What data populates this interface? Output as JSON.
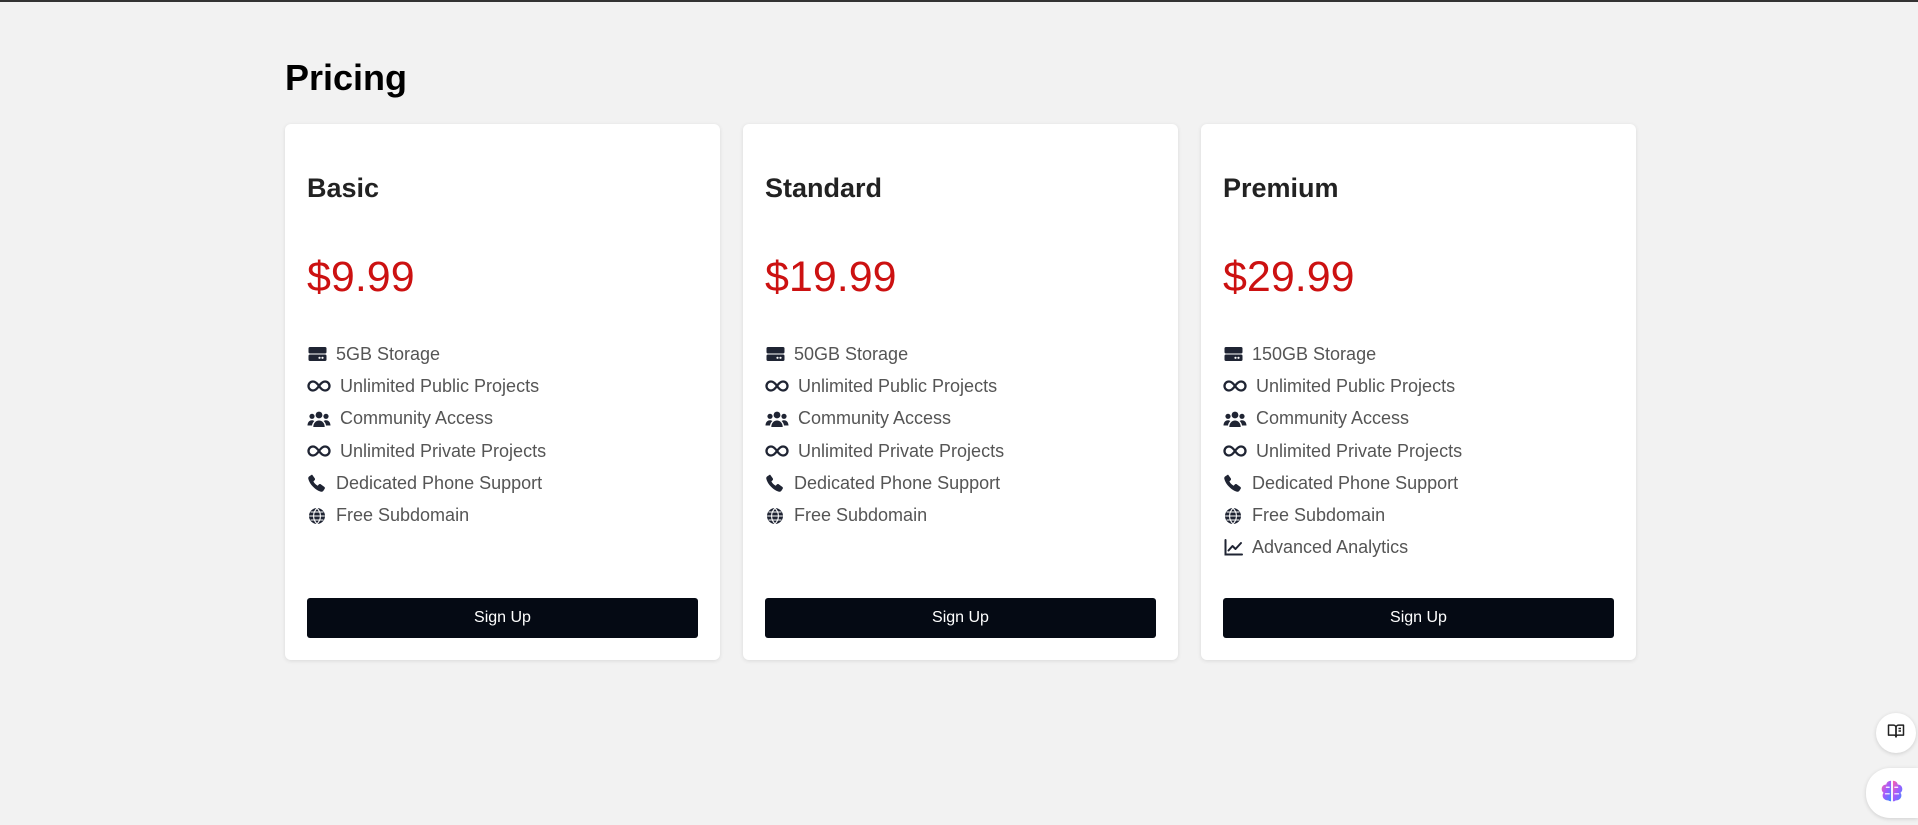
{
  "page": {
    "title": "Pricing"
  },
  "colors": {
    "price": "#cc1111",
    "button": "#050a14",
    "background": "#f2f2f2"
  },
  "plans": [
    {
      "name": "Basic",
      "price": "$9.99",
      "button_label": "Sign Up",
      "features": [
        {
          "icon": "storage-icon",
          "label": "5GB Storage"
        },
        {
          "icon": "infinity-icon",
          "label": "Unlimited Public Projects"
        },
        {
          "icon": "users-icon",
          "label": "Community Access"
        },
        {
          "icon": "infinity-icon",
          "label": "Unlimited Private Projects"
        },
        {
          "icon": "phone-icon",
          "label": "Dedicated Phone Support"
        },
        {
          "icon": "globe-icon",
          "label": "Free Subdomain"
        }
      ]
    },
    {
      "name": "Standard",
      "price": "$19.99",
      "button_label": "Sign Up",
      "features": [
        {
          "icon": "storage-icon",
          "label": "50GB Storage"
        },
        {
          "icon": "infinity-icon",
          "label": "Unlimited Public Projects"
        },
        {
          "icon": "users-icon",
          "label": "Community Access"
        },
        {
          "icon": "infinity-icon",
          "label": "Unlimited Private Projects"
        },
        {
          "icon": "phone-icon",
          "label": "Dedicated Phone Support"
        },
        {
          "icon": "globe-icon",
          "label": "Free Subdomain"
        }
      ]
    },
    {
      "name": "Premium",
      "price": "$29.99",
      "button_label": "Sign Up",
      "features": [
        {
          "icon": "storage-icon",
          "label": "150GB Storage"
        },
        {
          "icon": "infinity-icon",
          "label": "Unlimited Public Projects"
        },
        {
          "icon": "users-icon",
          "label": "Community Access"
        },
        {
          "icon": "infinity-icon",
          "label": "Unlimited Private Projects"
        },
        {
          "icon": "phone-icon",
          "label": "Dedicated Phone Support"
        },
        {
          "icon": "globe-icon",
          "label": "Free Subdomain"
        },
        {
          "icon": "chart-line-icon",
          "label": "Advanced Analytics"
        }
      ]
    }
  ],
  "floating_buttons": [
    {
      "icon": "book-icon"
    },
    {
      "icon": "brain-icon"
    }
  ]
}
